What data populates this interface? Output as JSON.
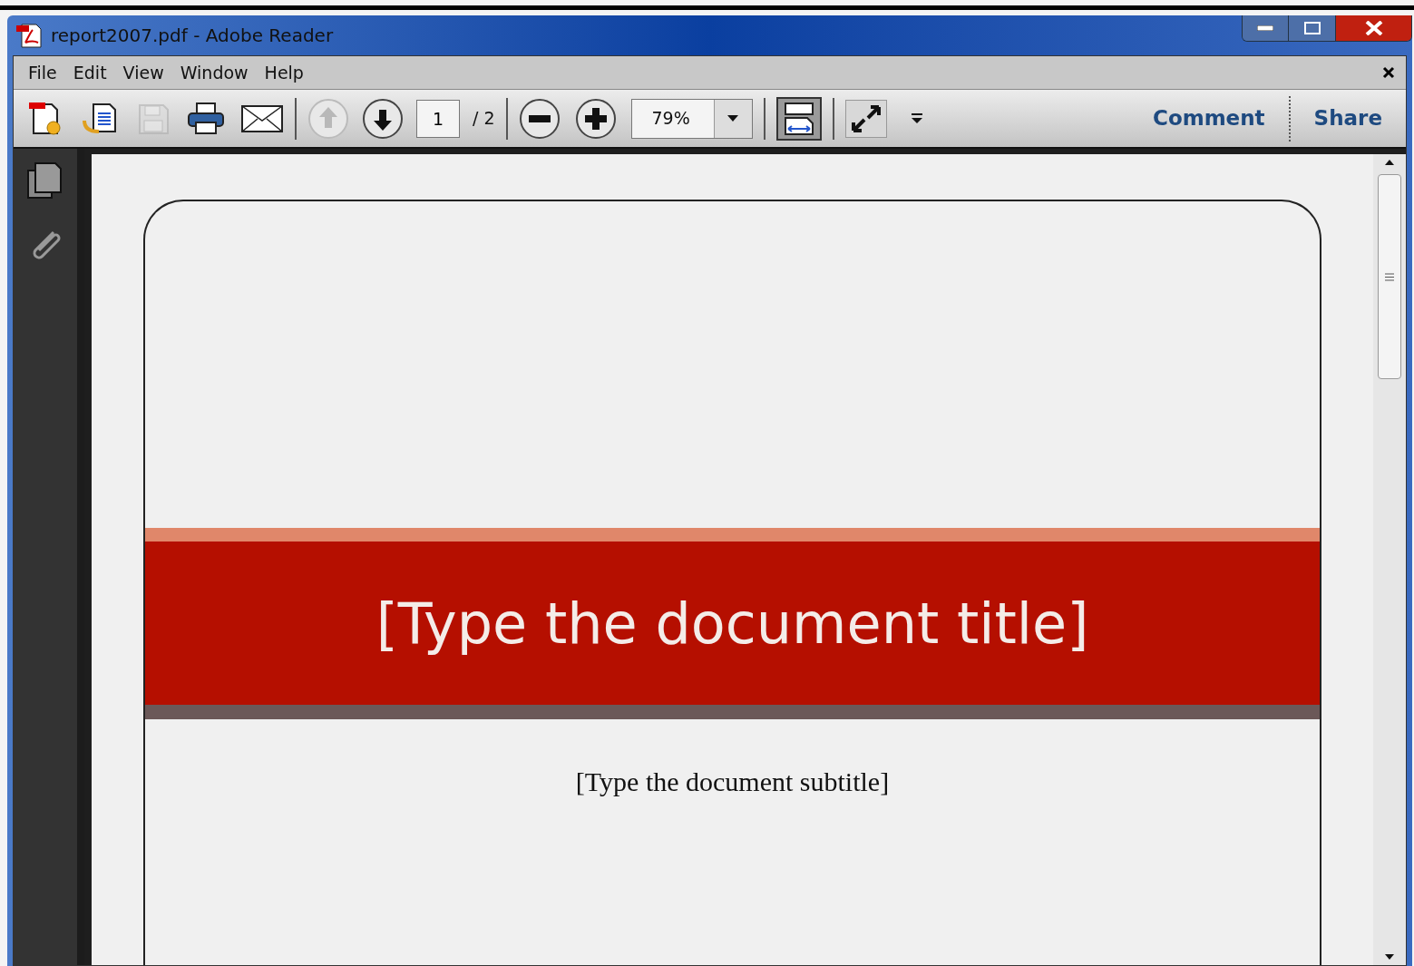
{
  "window": {
    "title": "report2007.pdf - Adobe Reader"
  },
  "menu": [
    "File",
    "Edit",
    "View",
    "Window",
    "Help"
  ],
  "toolbar": {
    "file_tools": [
      {
        "kind": "create",
        "disabled": false
      },
      {
        "kind": "export",
        "disabled": false
      },
      {
        "kind": "save",
        "disabled": true
      },
      {
        "kind": "print",
        "disabled": false
      },
      {
        "kind": "email",
        "disabled": false
      }
    ],
    "nav_tools": [
      {
        "kind": "previous",
        "disabled": true
      },
      {
        "kind": "next",
        "disabled": false
      }
    ],
    "page_number": "1",
    "page_total": "/ 2",
    "zoom": "79%",
    "view_tools": [
      {
        "kind": "fit-width",
        "pressed": true
      },
      {
        "kind": "full-screen",
        "pressed": false
      }
    ],
    "panels": [
      "Comment",
      "Share"
    ]
  },
  "document": {
    "title": "[Type the document title]",
    "subtitle": "[Type the document subtitle]"
  }
}
